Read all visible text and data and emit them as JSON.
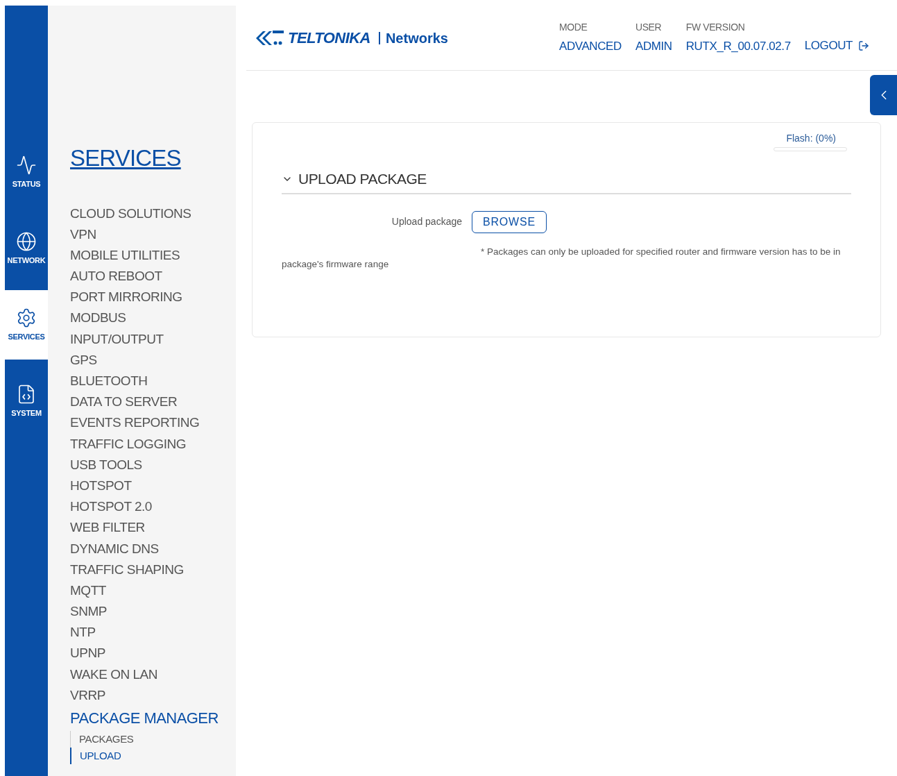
{
  "nav_rail": [
    {
      "label": "STATUS",
      "selected": false
    },
    {
      "label": "NETWORK",
      "selected": false
    },
    {
      "label": "SERVICES",
      "selected": true
    },
    {
      "label": "SYSTEM",
      "selected": false
    }
  ],
  "submenu": {
    "title": "SERVICES",
    "items": [
      {
        "label": "CLOUD SOLUTIONS",
        "selected": false
      },
      {
        "label": "VPN",
        "selected": false
      },
      {
        "label": "MOBILE UTILITIES",
        "selected": false
      },
      {
        "label": "AUTO REBOOT",
        "selected": false
      },
      {
        "label": "PORT MIRRORING",
        "selected": false
      },
      {
        "label": "MODBUS",
        "selected": false
      },
      {
        "label": "INPUT/OUTPUT",
        "selected": false
      },
      {
        "label": "GPS",
        "selected": false
      },
      {
        "label": "BLUETOOTH",
        "selected": false
      },
      {
        "label": "DATA TO SERVER",
        "selected": false
      },
      {
        "label": "EVENTS REPORTING",
        "selected": false
      },
      {
        "label": "TRAFFIC LOGGING",
        "selected": false
      },
      {
        "label": "USB TOOLS",
        "selected": false
      },
      {
        "label": "HOTSPOT",
        "selected": false
      },
      {
        "label": "HOTSPOT 2.0",
        "selected": false
      },
      {
        "label": "WEB FILTER",
        "selected": false
      },
      {
        "label": "DYNAMIC DNS",
        "selected": false
      },
      {
        "label": "TRAFFIC SHAPING",
        "selected": false
      },
      {
        "label": "MQTT",
        "selected": false
      },
      {
        "label": "SNMP",
        "selected": false
      },
      {
        "label": "NTP",
        "selected": false
      },
      {
        "label": "UPNP",
        "selected": false
      },
      {
        "label": "WAKE ON LAN",
        "selected": false
      },
      {
        "label": "VRRP",
        "selected": false
      },
      {
        "label": "PACKAGE MANAGER",
        "selected": true,
        "children": [
          {
            "label": "PACKAGES",
            "selected": false
          },
          {
            "label": "UPLOAD",
            "selected": true
          }
        ]
      }
    ]
  },
  "header": {
    "logo": {
      "brand": "TELTONIKA",
      "suffix": "Networks"
    },
    "info": [
      {
        "label": "MODE",
        "value": "ADVANCED"
      },
      {
        "label": "USER",
        "value": "ADMIN"
      },
      {
        "label": "FW VERSION",
        "value": "RUTX_R_00.07.02.7"
      }
    ],
    "logout": "LOGOUT"
  },
  "card": {
    "flash": {
      "text": "Flash: (0%)",
      "level": 0
    },
    "section": {
      "title": "UPLOAD PACKAGE",
      "expanded": true,
      "field_label": "Upload package",
      "button": "BROWSE",
      "note": "* Packages can only be uploaded for specified router and firmware version has to be in package's firmware range"
    }
  }
}
